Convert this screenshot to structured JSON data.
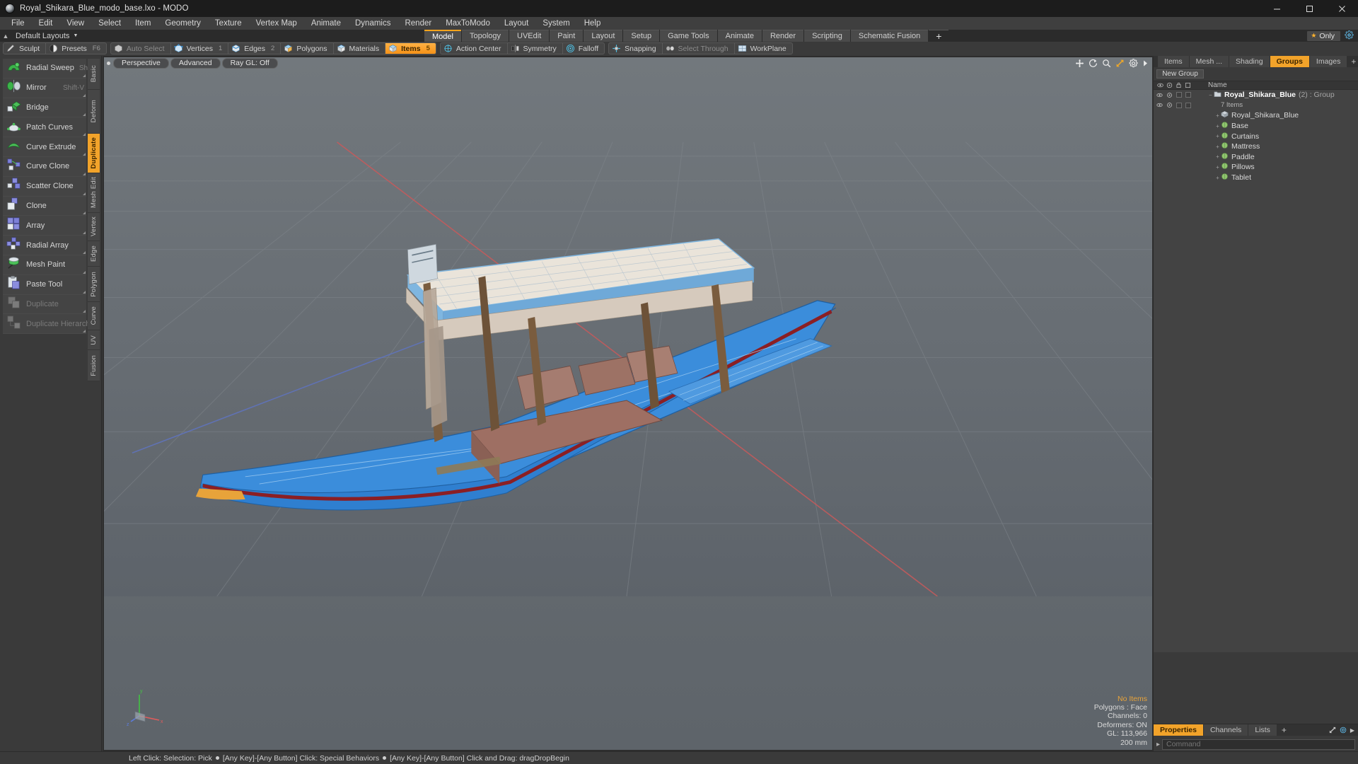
{
  "window": {
    "title": "Royal_Shikara_Blue_modo_base.lxo - MODO",
    "app_icon": "modo-sphere-icon",
    "minimize": "minimize-icon",
    "maximize": "maximize-icon",
    "close": "close-icon"
  },
  "menubar": {
    "items": [
      "File",
      "Edit",
      "View",
      "Select",
      "Item",
      "Geometry",
      "Texture",
      "Vertex Map",
      "Animate",
      "Dynamics",
      "Render",
      "MaxToModo",
      "Layout",
      "System",
      "Help"
    ]
  },
  "layoutbar": {
    "preset_label": "Default Layouts",
    "tabs": [
      {
        "label": "Model",
        "active": true
      },
      {
        "label": "Topology",
        "active": false
      },
      {
        "label": "UVEdit",
        "active": false
      },
      {
        "label": "Paint",
        "active": false
      },
      {
        "label": "Layout",
        "active": false
      },
      {
        "label": "Setup",
        "active": false
      },
      {
        "label": "Game Tools",
        "active": false
      },
      {
        "label": "Animate",
        "active": false
      },
      {
        "label": "Render",
        "active": false
      },
      {
        "label": "Scripting",
        "active": false
      },
      {
        "label": "Schematic Fusion",
        "active": false
      }
    ],
    "add_tab": "+",
    "only_label": "Only",
    "gear": "gear-icon"
  },
  "modebar": {
    "group_a": [
      {
        "label": "Sculpt",
        "icon": "sculpt-icon",
        "active": false,
        "dim": false,
        "num": ""
      },
      {
        "label": "Presets",
        "icon": "presets-sphere-icon",
        "active": false,
        "dim": false,
        "num": "F6"
      }
    ],
    "group_b": [
      {
        "label": "Auto Select",
        "icon": "auto-select-icon",
        "active": false,
        "dim": true,
        "num": ""
      },
      {
        "label": "Vertices",
        "icon": "vertices-icon",
        "active": false,
        "dim": false,
        "num": "1"
      },
      {
        "label": "Edges",
        "icon": "edges-icon",
        "active": false,
        "dim": false,
        "num": "2"
      },
      {
        "label": "Polygons",
        "icon": "polygons-icon",
        "active": false,
        "dim": false,
        "num": ""
      },
      {
        "label": "Materials",
        "icon": "materials-icon",
        "active": false,
        "dim": false,
        "num": ""
      },
      {
        "label": "Items",
        "icon": "items-icon",
        "active": true,
        "dim": false,
        "num": "5"
      }
    ],
    "group_c": [
      {
        "label": "Action Center",
        "icon": "action-center-icon",
        "active": false,
        "dim": false,
        "num": ""
      },
      {
        "label": "Symmetry",
        "icon": "symmetry-icon",
        "active": false,
        "dim": false,
        "num": ""
      },
      {
        "label": "Falloff",
        "icon": "falloff-icon",
        "active": false,
        "dim": false,
        "num": ""
      }
    ],
    "group_d": [
      {
        "label": "Snapping",
        "icon": "snapping-icon",
        "active": false,
        "dim": false,
        "num": ""
      },
      {
        "label": "Select Through",
        "icon": "select-through-icon",
        "active": false,
        "dim": true,
        "num": ""
      },
      {
        "label": "WorkPlane",
        "icon": "workplane-icon",
        "active": false,
        "dim": false,
        "num": ""
      }
    ]
  },
  "tools": {
    "items": [
      {
        "label": "Radial Sweep",
        "shortcut": "Shift-L",
        "icon": "radial-sweep-icon",
        "disabled": false
      },
      {
        "label": "Mirror",
        "shortcut": "Shift-V",
        "icon": "mirror-icon",
        "disabled": false
      },
      {
        "label": "Bridge",
        "shortcut": "",
        "icon": "bridge-icon",
        "disabled": false
      },
      {
        "label": "Patch Curves",
        "shortcut": "",
        "icon": "patch-curves-icon",
        "disabled": false
      },
      {
        "label": "Curve Extrude",
        "shortcut": "",
        "icon": "curve-extrude-icon",
        "disabled": false
      },
      {
        "label": "Curve Clone",
        "shortcut": "",
        "icon": "curve-clone-icon",
        "disabled": false
      },
      {
        "label": "Scatter Clone",
        "shortcut": "",
        "icon": "scatter-clone-icon",
        "disabled": false
      },
      {
        "label": "Clone",
        "shortcut": "",
        "icon": "clone-icon",
        "disabled": false
      },
      {
        "label": "Array",
        "shortcut": "",
        "icon": "array-icon",
        "disabled": false
      },
      {
        "label": "Radial Array",
        "shortcut": "",
        "icon": "radial-array-icon",
        "disabled": false
      },
      {
        "label": "Mesh Paint",
        "shortcut": "",
        "icon": "mesh-paint-icon",
        "disabled": false
      },
      {
        "label": "Paste Tool",
        "shortcut": "",
        "icon": "paste-tool-icon",
        "disabled": false
      },
      {
        "label": "Duplicate",
        "shortcut": "",
        "icon": "duplicate-icon",
        "disabled": true
      },
      {
        "label": "Duplicate Hierarchy",
        "shortcut": "",
        "icon": "duplicate-hierarchy-icon",
        "disabled": true
      }
    ],
    "categories": [
      {
        "label": "Basic",
        "active": false
      },
      {
        "label": "Deform",
        "active": false
      },
      {
        "label": "Duplicate",
        "active": true
      },
      {
        "label": "Mesh Edit",
        "active": false
      },
      {
        "label": "Vertex",
        "active": false
      },
      {
        "label": "Edge",
        "active": false
      },
      {
        "label": "Polygon",
        "active": false
      },
      {
        "label": "Curve",
        "active": false
      },
      {
        "label": "UV",
        "active": false
      },
      {
        "label": "Fusion",
        "active": false
      }
    ]
  },
  "viewport": {
    "buttons": [
      "Perspective",
      "Advanced",
      "Ray GL: Off"
    ],
    "corner_icons": [
      "move-icon",
      "rotate-icon",
      "zoom-icon",
      "fit-icon",
      "gear-icon",
      "chevron-right-icon"
    ],
    "axis_gizmo": "axis-gizmo",
    "axis_labels": {
      "x": "x",
      "y": "y",
      "z": "z"
    },
    "hud": {
      "no_items": "No Items",
      "polygons": "Polygons : Face",
      "channels": "Channels: 0",
      "deformers": "Deformers: ON",
      "gl": "GL: 113,966",
      "scale": "200 mm"
    }
  },
  "right_panel": {
    "tabs": [
      {
        "label": "Items",
        "active": false
      },
      {
        "label": "Mesh ...",
        "active": false
      },
      {
        "label": "Shading",
        "active": false
      },
      {
        "label": "Groups",
        "active": true
      },
      {
        "label": "Images",
        "active": false
      },
      {
        "label": "+",
        "active": false
      }
    ],
    "new_group_label": "New Group",
    "column_header": "Name",
    "gutter_icons": [
      "eye-icon",
      "render-icon",
      "lock-icon",
      "select-icon"
    ],
    "tree": [
      {
        "label": "Royal_Shikara_Blue",
        "suffix": "(2) : Group",
        "type": "group",
        "indent": 0,
        "icon": "group-icon"
      },
      {
        "label": "7 Items",
        "suffix": "",
        "type": "count",
        "indent": 1,
        "icon": ""
      },
      {
        "label": "Royal_Shikara_Blue",
        "suffix": "",
        "type": "mesh",
        "indent": 1,
        "icon": "mesh-icon"
      },
      {
        "label": "Base",
        "suffix": "",
        "type": "material",
        "indent": 1,
        "icon": "material-icon"
      },
      {
        "label": "Curtains",
        "suffix": "",
        "type": "material",
        "indent": 1,
        "icon": "material-icon"
      },
      {
        "label": "Mattress",
        "suffix": "",
        "type": "material",
        "indent": 1,
        "icon": "material-icon"
      },
      {
        "label": "Paddle",
        "suffix": "",
        "type": "material",
        "indent": 1,
        "icon": "material-icon"
      },
      {
        "label": "Pillows",
        "suffix": "",
        "type": "material",
        "indent": 1,
        "icon": "material-icon"
      },
      {
        "label": "Tablet",
        "suffix": "",
        "type": "material",
        "indent": 1,
        "icon": "material-icon"
      }
    ],
    "properties_tabs": [
      {
        "label": "Properties",
        "active": true
      },
      {
        "label": "Channels",
        "active": false
      },
      {
        "label": "Lists",
        "active": false
      },
      {
        "label": "+",
        "active": false
      }
    ],
    "command_placeholder": "Command"
  },
  "statusbar": {
    "hints": [
      "Left Click: Selection: Pick",
      "[Any Key]-[Any Button] Click: Special Behaviors",
      "[Any Key]-[Any Button] Click and Drag: dragDropBegin"
    ]
  },
  "colors": {
    "accent": "#f2a32a",
    "panel": "#3a3a3a",
    "titlebar": "#1c1c1c",
    "viewport_top": "#6e7479",
    "boat_blue": "#2f7fd0",
    "boat_red": "#8b1f24"
  }
}
